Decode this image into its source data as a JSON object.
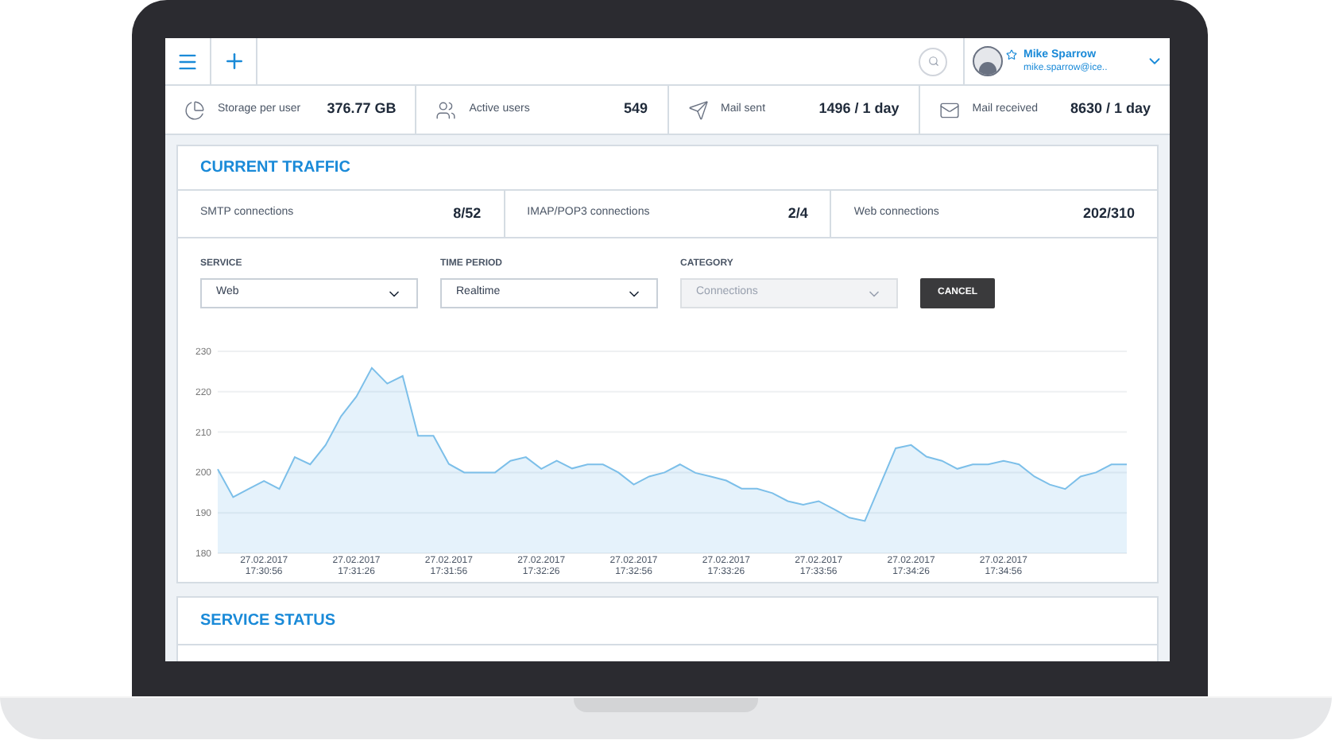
{
  "top_bar": {
    "user": {
      "name": "Mike Sparrow",
      "email": "mike.sparrow@ice.."
    }
  },
  "stats": [
    {
      "kind": "storage",
      "label": "Storage per user",
      "value": "376.77 GB"
    },
    {
      "kind": "users",
      "label": "Active users",
      "value": "549"
    },
    {
      "kind": "sent",
      "label": "Mail sent",
      "value": "1496 / 1 day"
    },
    {
      "kind": "received",
      "label": "Mail received",
      "value": "8630 / 1 day"
    }
  ],
  "current_traffic": {
    "title": "CURRENT TRAFFIC",
    "connections": [
      {
        "label": "SMTP connections",
        "value": "8/52"
      },
      {
        "label": "IMAP/POP3 connections",
        "value": "2/4"
      },
      {
        "label": "Web connections",
        "value": "202/310"
      }
    ],
    "filters": [
      {
        "label": "SERVICE",
        "value": "Web",
        "disabled": false
      },
      {
        "label": "TIME PERIOD",
        "value": "Realtime",
        "disabled": false
      },
      {
        "label": "CATEGORY",
        "value": "Connections",
        "disabled": true
      }
    ],
    "cancel_button": "CANCEL",
    "chart_data": {
      "type": "area",
      "categories": [
        null,
        null,
        null,
        "27.02.2017 17:30:56",
        null,
        null,
        null,
        null,
        null,
        "27.02.2017 17:31:26",
        null,
        null,
        null,
        null,
        null,
        "27.02.2017 17:31:56",
        null,
        null,
        null,
        null,
        null,
        "27.02.2017 17:32:26",
        null,
        null,
        null,
        null,
        null,
        "27.02.2017 17:32:56",
        null,
        null,
        null,
        null,
        null,
        "27.02.2017 17:33:26",
        null,
        null,
        null,
        null,
        null,
        "27.02.2017 17:33:56",
        null,
        null,
        null,
        null,
        null,
        "27.02.2017 17:34:26",
        null,
        null,
        null,
        null,
        null,
        "27.02.2017 17:34:56",
        null,
        null,
        null,
        null,
        null,
        null,
        null,
        null
      ],
      "series": [
        {
          "color": "#7cbfe9",
          "values": [
            200.8,
            193.9,
            195.9,
            197.9,
            195.9,
            203.8,
            202,
            206.8,
            213.9,
            218.8,
            225.9,
            222,
            223.9,
            209.1,
            209.1,
            202.1,
            200,
            200,
            200,
            202.9,
            203.8,
            200.9,
            202.9,
            201,
            202,
            202,
            200,
            197,
            199,
            200,
            202,
            199.9,
            199,
            198,
            196,
            196,
            194.9,
            192.9,
            192,
            192.9,
            190.9,
            188.8,
            188,
            197,
            206,
            206.8,
            203.9,
            202.9,
            200.9,
            202,
            202,
            202.9,
            202,
            199,
            197,
            195.9,
            199,
            200,
            202,
            202
          ]
        }
      ],
      "ylim": [
        180,
        230
      ],
      "grid": true,
      "yticks": [
        180,
        190,
        200,
        210,
        220,
        230
      ]
    }
  },
  "service_status": {
    "title": "SERVICE STATUS"
  }
}
